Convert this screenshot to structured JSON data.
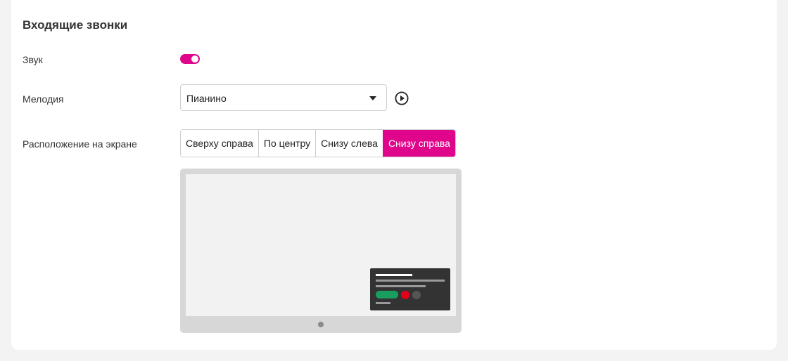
{
  "colors": {
    "accent": "#e0068b",
    "accept": "#1a9e5f",
    "decline": "#e3001b"
  },
  "section": {
    "title": "Входящие звонки"
  },
  "sound": {
    "label": "Звук",
    "enabled": true
  },
  "melody": {
    "label": "Мелодия",
    "value": "Пианино",
    "play_icon": "play-circle-icon",
    "caret_icon": "caret-down-icon"
  },
  "position": {
    "label": "Расположение на экране",
    "options": [
      "Сверху справа",
      "По центру",
      "Снизу слева",
      "Снизу справа"
    ],
    "selected": "Снизу справа"
  }
}
